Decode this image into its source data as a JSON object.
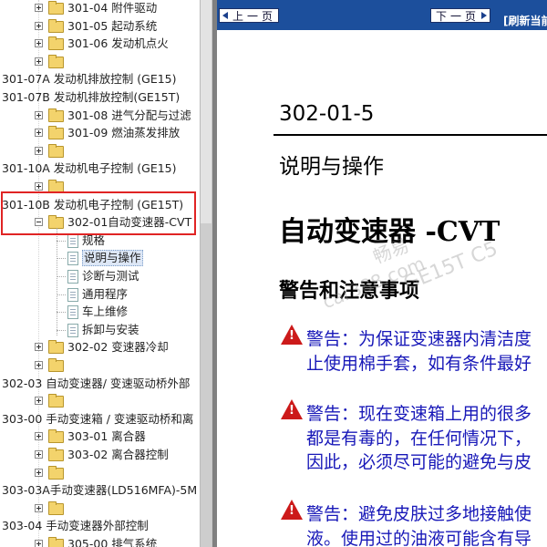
{
  "tree": {
    "items": [
      {
        "label": "301-04 附件驱动",
        "kind": "folder",
        "exp": "plus"
      },
      {
        "label": "301-05 起动系统",
        "kind": "folder",
        "exp": "plus"
      },
      {
        "label": "301-06 发动机点火",
        "kind": "folder",
        "exp": "plus"
      },
      {
        "label": "",
        "kind": "folder",
        "exp": "plus"
      },
      {
        "label": "301-07A 发动机排放控制 (GE15)",
        "kind": "text"
      },
      {
        "label": "301-07B 发动机排放控制(GE15T)",
        "kind": "text"
      },
      {
        "label": "301-08 进气分配与过滤",
        "kind": "folder",
        "exp": "plus"
      },
      {
        "label": "301-09 燃油蒸发排放",
        "kind": "folder",
        "exp": "plus"
      },
      {
        "label": "",
        "kind": "folder",
        "exp": "plus"
      },
      {
        "label": "301-10A 发动机电子控制 (GE15)",
        "kind": "text"
      },
      {
        "label": "",
        "kind": "folder",
        "exp": "plus"
      },
      {
        "label": "301-10B 发动机电子控制 (GE15T)",
        "kind": "text"
      },
      {
        "label": "302-01自动变速器-CVT",
        "kind": "folder",
        "exp": "minus"
      },
      {
        "label": "规格",
        "kind": "page"
      },
      {
        "label": "说明与操作",
        "kind": "page",
        "selected": true
      },
      {
        "label": "诊断与测试",
        "kind": "page"
      },
      {
        "label": "通用程序",
        "kind": "page"
      },
      {
        "label": "车上维修",
        "kind": "page"
      },
      {
        "label": "拆卸与安装",
        "kind": "page"
      },
      {
        "label": "302-02 变速器冷却",
        "kind": "folder",
        "exp": "plus"
      },
      {
        "label": "",
        "kind": "folder",
        "exp": "plus"
      },
      {
        "label": "302-03 自动变速器/ 变速驱动桥外部",
        "kind": "text"
      },
      {
        "label": "",
        "kind": "folder",
        "exp": "plus"
      },
      {
        "label": "303-00 手动变速箱 / 变速驱动桥和离",
        "kind": "text"
      },
      {
        "label": "303-01 离合器",
        "kind": "folder",
        "exp": "plus"
      },
      {
        "label": "303-02 离合器控制",
        "kind": "folder",
        "exp": "plus"
      },
      {
        "label": "",
        "kind": "folder",
        "exp": "plus"
      },
      {
        "label": "303-03A手动变速器(LD516MFA)-5M",
        "kind": "text"
      },
      {
        "label": "",
        "kind": "folder",
        "exp": "plus"
      },
      {
        "label": "303-04 手动变速器外部控制",
        "kind": "text"
      },
      {
        "label": "305-00 排气系统",
        "kind": "folder",
        "exp": "plus"
      }
    ]
  },
  "nav": {
    "prev": "上一页",
    "next": "下一页",
    "refresh": "[刷新当前"
  },
  "doc": {
    "section_number": "302-01-5",
    "section_heading": "说明与操作",
    "title": "自动变速器 -CVT",
    "subtitle": "警告和注意事项",
    "warnings": [
      {
        "line1": "警告：为保证变速器内清洁度",
        "line2": "止使用棉手套，如有条件最好"
      },
      {
        "line1": "警告：现在变速箱上用的很多",
        "line2": "都是有毒的，在任何情况下，",
        "line3": "因此，必须尽可能的避免与皮"
      },
      {
        "line1": "警告：避免皮肤过多地接触使",
        "line2": "液。使用过的油液可能含有导"
      }
    ]
  },
  "watermark": {
    "line1": "畅易",
    "line2": "car388.com",
    "line3": "GE15T C5"
  }
}
